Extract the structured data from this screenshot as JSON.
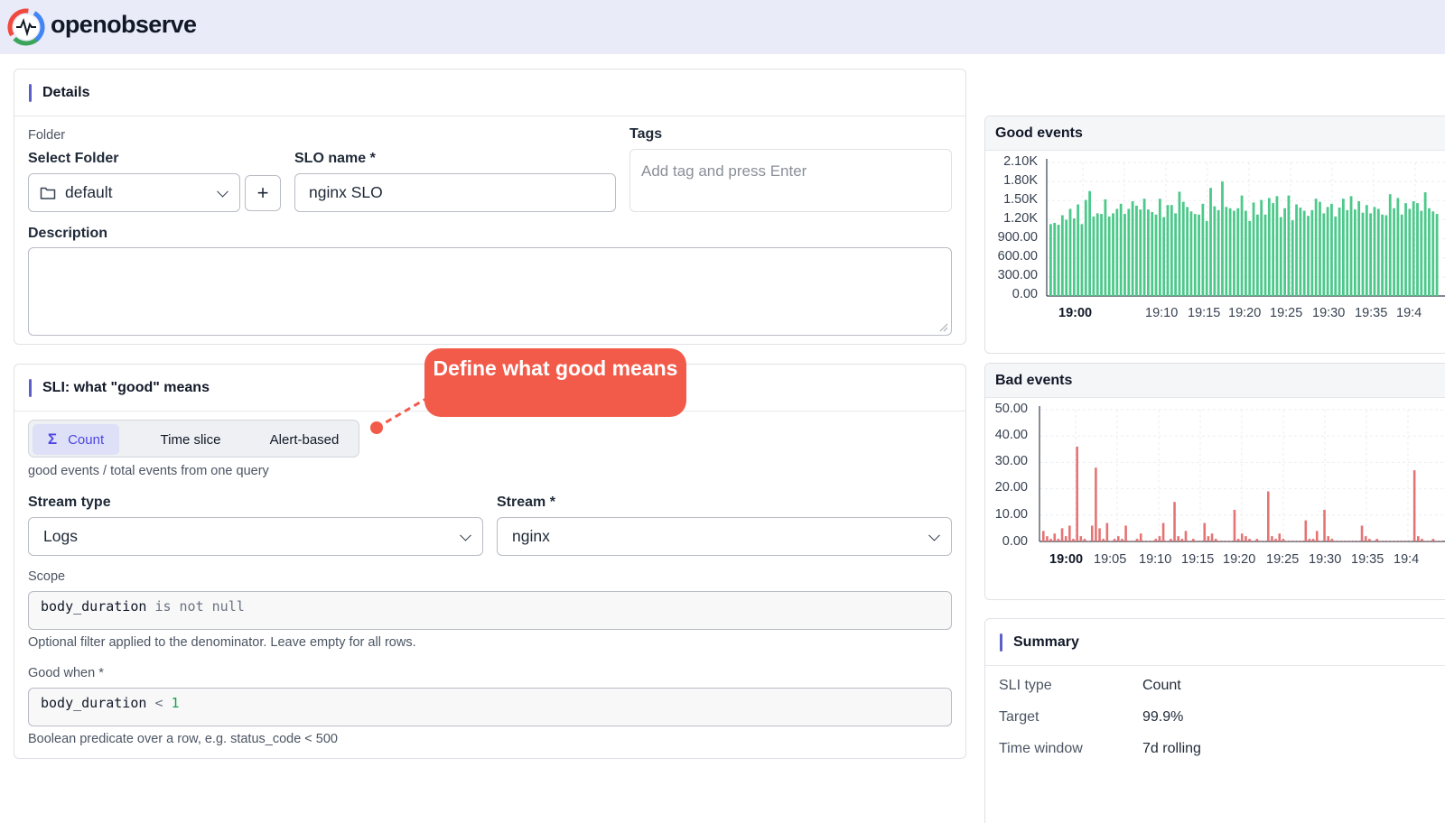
{
  "app": {
    "brand": "openobserve"
  },
  "details": {
    "title": "Details",
    "folder_caption": "Folder",
    "select_folder_label": "Select Folder",
    "folder_value": "default",
    "add_button": "+",
    "slo_name_label": "SLO name *",
    "slo_name_value": "nginx SLO",
    "tags_label": "Tags",
    "tags_placeholder": "Add tag and press Enter",
    "description_label": "Description",
    "description_value": ""
  },
  "sli": {
    "title": "SLI: what \"good\" means",
    "modes": [
      {
        "label": "Count",
        "icon": "sigma-icon",
        "active": true
      },
      {
        "label": "Time slice",
        "active": false
      },
      {
        "label": "Alert-based",
        "active": false
      }
    ],
    "mode_help": "good events / total events from one query",
    "stream_type_label": "Stream type",
    "stream_type_value": "Logs",
    "stream_label": "Stream *",
    "stream_value": "nginx",
    "scope_label": "Scope",
    "scope_field": "body_duration",
    "scope_op": "is not null",
    "scope_help": "Optional filter applied to the denominator. Leave empty for all rows.",
    "good_when_label": "Good when *",
    "good_field": "body_duration",
    "good_op": "<",
    "good_value": "1",
    "good_help": "Boolean predicate over a row, e.g. status_code < 500"
  },
  "annotation": {
    "text": "Define what good means",
    "color": "#f25b4a"
  },
  "charts": {
    "good_title": "Good events",
    "bad_title": "Bad events",
    "good_color": "#4cc98a",
    "bad_color": "#e57373",
    "good_y_ticks": [
      "2.10K",
      "1.80K",
      "1.50K",
      "1.20K",
      "900.00",
      "600.00",
      "300.00",
      "0.00"
    ],
    "good_x_ticks": [
      "19:00",
      "19:10",
      "19:15",
      "19:20",
      "19:25",
      "19:30",
      "19:35",
      "19:4"
    ],
    "bad_y_ticks": [
      "50.00",
      "40.00",
      "30.00",
      "20.00",
      "10.00",
      "0.00"
    ],
    "bad_x_ticks": [
      "19:00",
      "19:05",
      "19:10",
      "19:15",
      "19:20",
      "19:25",
      "19:30",
      "19:35",
      "19:4"
    ]
  },
  "chart_data": [
    {
      "type": "bar",
      "title": "Good events",
      "ylim": [
        0,
        2100
      ],
      "x_start": "19:00",
      "interval": "~30s",
      "values": [
        1130,
        1150,
        1120,
        1270,
        1200,
        1370,
        1220,
        1440,
        1130,
        1510,
        1650,
        1250,
        1300,
        1290,
        1520,
        1250,
        1300,
        1370,
        1450,
        1290,
        1370,
        1490,
        1420,
        1360,
        1530,
        1360,
        1320,
        1280,
        1530,
        1240,
        1430,
        1430,
        1300,
        1640,
        1480,
        1400,
        1330,
        1290,
        1280,
        1450,
        1180,
        1700,
        1410,
        1350,
        1800,
        1400,
        1380,
        1340,
        1380,
        1580,
        1340,
        1180,
        1470,
        1280,
        1510,
        1280,
        1540,
        1460,
        1570,
        1240,
        1380,
        1580,
        1190,
        1440,
        1390,
        1340,
        1260,
        1350,
        1530,
        1480,
        1300,
        1400,
        1450,
        1250,
        1390,
        1530,
        1350,
        1570,
        1360,
        1490,
        1310,
        1430,
        1300,
        1400,
        1370,
        1280,
        1270,
        1600,
        1380,
        1540,
        1280,
        1460,
        1370,
        1490,
        1460,
        1340,
        1630,
        1380,
        1330,
        1290
      ],
      "xlabel": "",
      "ylabel": ""
    },
    {
      "type": "bar",
      "title": "Bad events",
      "ylim": [
        0,
        50
      ],
      "x_start": "19:00",
      "interval": "~30s",
      "values": [
        4,
        2,
        1,
        3,
        1,
        5,
        2,
        6,
        1,
        36,
        2,
        1,
        0,
        6,
        28,
        5,
        1,
        7,
        0,
        1,
        2,
        1,
        6,
        0,
        0,
        1,
        3,
        0,
        0,
        0,
        1,
        2,
        7,
        0,
        1,
        15,
        2,
        1,
        4,
        0,
        1,
        0,
        0,
        7,
        2,
        3,
        1,
        0,
        0,
        0,
        0,
        12,
        1,
        3,
        2,
        1,
        0,
        1,
        0,
        0,
        19,
        2,
        1,
        3,
        1,
        0,
        0,
        0,
        0,
        0,
        8,
        1,
        1,
        4,
        0,
        12,
        2,
        1,
        0,
        0,
        0,
        0,
        0,
        0,
        0,
        6,
        2,
        1,
        0,
        1,
        0,
        0,
        0,
        0,
        0,
        0,
        0,
        0,
        0,
        27,
        2,
        1,
        0,
        0,
        1,
        0,
        0,
        0,
        3,
        12,
        2,
        1,
        0
      ],
      "xlabel": "",
      "ylabel": ""
    }
  ],
  "summary": {
    "title": "Summary",
    "rows": [
      {
        "key": "SLI type",
        "value": "Count"
      },
      {
        "key": "Target",
        "value": "99.9%"
      },
      {
        "key": "Time window",
        "value": "7d rolling"
      }
    ]
  }
}
